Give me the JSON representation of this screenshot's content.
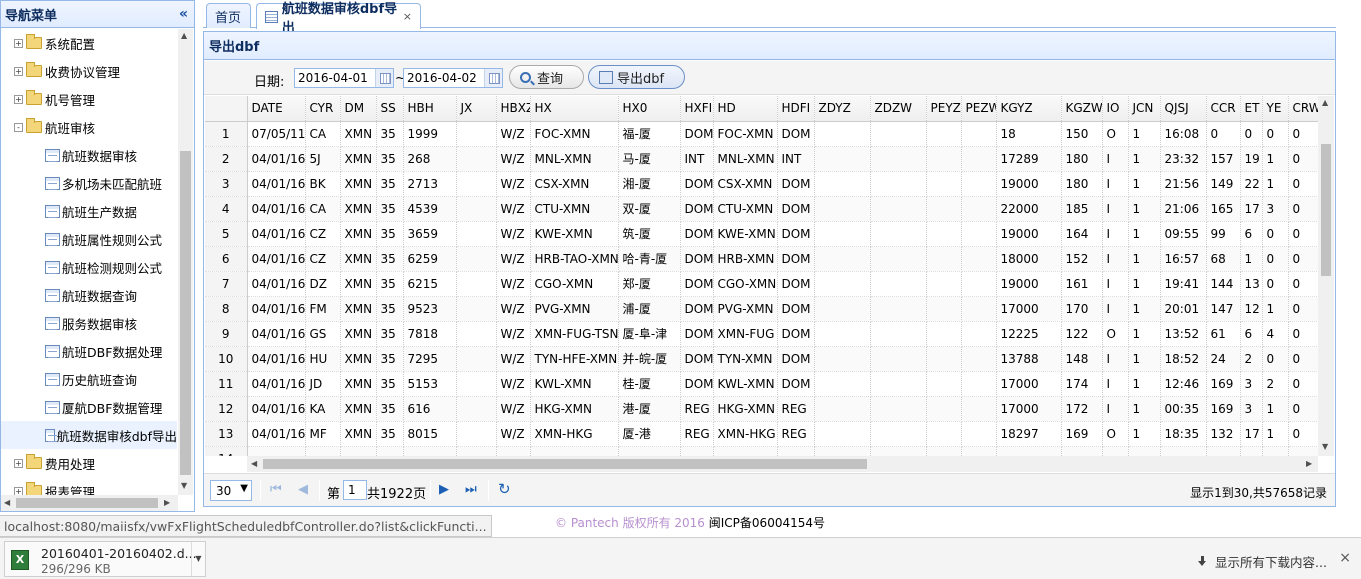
{
  "sidebar": {
    "title": "导航菜单",
    "collapse_icon": "«",
    "nodes": [
      {
        "label": "系统配置",
        "type": "folder",
        "state": "+"
      },
      {
        "label": "收费协议管理",
        "type": "folder",
        "state": "+"
      },
      {
        "label": "机号管理",
        "type": "folder",
        "state": "+"
      },
      {
        "label": "航班审核",
        "type": "folder",
        "state": "-"
      },
      {
        "label": "航班数据审核",
        "type": "file"
      },
      {
        "label": "多机场未匹配航班",
        "type": "file"
      },
      {
        "label": "航班生产数据",
        "type": "file"
      },
      {
        "label": "航班属性规则公式",
        "type": "file"
      },
      {
        "label": "航班检测规则公式",
        "type": "file"
      },
      {
        "label": "航班数据查询",
        "type": "file"
      },
      {
        "label": "服务数据审核",
        "type": "file"
      },
      {
        "label": "航班DBF数据处理",
        "type": "file"
      },
      {
        "label": "历史航班查询",
        "type": "file"
      },
      {
        "label": "厦航DBF数据管理",
        "type": "file"
      },
      {
        "label": "航班数据审核dbf导出",
        "type": "file",
        "selected": true
      },
      {
        "label": "费用处理",
        "type": "folder",
        "state": "+"
      },
      {
        "label": "报表管理",
        "type": "folder",
        "state": "+"
      }
    ]
  },
  "tabs": {
    "home": "首页",
    "active": "航班数据审核dbf导出",
    "close": "×"
  },
  "panel": {
    "title": "导出dbf"
  },
  "toolbar": {
    "date_label": "日期:",
    "date_from": "2016-04-01",
    "date_sep": "~",
    "date_to": "2016-04-02",
    "query_label": "查询",
    "export_label": "导出dbf"
  },
  "grid": {
    "columns": [
      "DATE",
      "CYR",
      "DM",
      "SS",
      "HBH",
      "JX",
      "HBXZ",
      "HX",
      "HX0",
      "HXFI",
      "HD",
      "HDFI",
      "ZDYZ",
      "ZDZW",
      "PEYZ",
      "PEZW",
      "KGYZ",
      "KGZW",
      "IO",
      "JCN",
      "QJSJ",
      "CCR",
      "ET",
      "YE",
      "CRWH"
    ],
    "rows": [
      [
        "07/05/11",
        "CA",
        "XMN",
        "35",
        "1999",
        "",
        "W/Z",
        "FOC-XMN",
        "福-厦",
        "DOM",
        "FOC-XMN",
        "DOM",
        "",
        "",
        "",
        "",
        "18",
        "150",
        "O",
        "1",
        "16:08",
        "0",
        "0",
        "0",
        "0"
      ],
      [
        "04/01/16",
        "5J",
        "XMN",
        "35",
        "268",
        "",
        "W/Z",
        "MNL-XMN",
        "马-厦",
        "INT",
        "MNL-XMN",
        "INT",
        "",
        "",
        "",
        "",
        "17289",
        "180",
        "I",
        "1",
        "23:32",
        "157",
        "19",
        "1",
        "0"
      ],
      [
        "04/01/16",
        "BK",
        "XMN",
        "35",
        "2713",
        "",
        "W/Z",
        "CSX-XMN",
        "湘-厦",
        "DOM",
        "CSX-XMN",
        "DOM",
        "",
        "",
        "",
        "",
        "19000",
        "180",
        "I",
        "1",
        "21:56",
        "149",
        "22",
        "1",
        "0"
      ],
      [
        "04/01/16",
        "CA",
        "XMN",
        "35",
        "4539",
        "",
        "W/Z",
        "CTU-XMN",
        "双-厦",
        "DOM",
        "CTU-XMN",
        "DOM",
        "",
        "",
        "",
        "",
        "22000",
        "185",
        "I",
        "1",
        "21:06",
        "165",
        "17",
        "3",
        "0"
      ],
      [
        "04/01/16",
        "CZ",
        "XMN",
        "35",
        "3659",
        "",
        "W/Z",
        "KWE-XMN",
        "筑-厦",
        "DOM",
        "KWE-XMN",
        "DOM",
        "",
        "",
        "",
        "",
        "19000",
        "164",
        "I",
        "1",
        "09:55",
        "99",
        "6",
        "0",
        "0"
      ],
      [
        "04/01/16",
        "CZ",
        "XMN",
        "35",
        "6259",
        "",
        "W/Z",
        "HRB-TAO-XMN",
        "哈-青-厦",
        "DOM",
        "HRB-XMN",
        "DOM",
        "",
        "",
        "",
        "",
        "18000",
        "152",
        "I",
        "1",
        "16:57",
        "68",
        "1",
        "0",
        "0"
      ],
      [
        "04/01/16",
        "DZ",
        "XMN",
        "35",
        "6215",
        "",
        "W/Z",
        "CGO-XMN",
        "郑-厦",
        "DOM",
        "CGO-XMN",
        "DOM",
        "",
        "",
        "",
        "",
        "19000",
        "161",
        "I",
        "1",
        "19:41",
        "144",
        "13",
        "0",
        "0"
      ],
      [
        "04/01/16",
        "FM",
        "XMN",
        "35",
        "9523",
        "",
        "W/Z",
        "PVG-XMN",
        "浦-厦",
        "DOM",
        "PVG-XMN",
        "DOM",
        "",
        "",
        "",
        "",
        "17000",
        "170",
        "I",
        "1",
        "20:01",
        "147",
        "12",
        "1",
        "0"
      ],
      [
        "04/01/16",
        "GS",
        "XMN",
        "35",
        "7818",
        "",
        "W/Z",
        "XMN-FUG-TSN",
        "厦-阜-津",
        "DOM",
        "XMN-FUG",
        "DOM",
        "",
        "",
        "",
        "",
        "12225",
        "122",
        "O",
        "1",
        "13:52",
        "61",
        "6",
        "4",
        "0"
      ],
      [
        "04/01/16",
        "HU",
        "XMN",
        "35",
        "7295",
        "",
        "W/Z",
        "TYN-HFE-XMN",
        "并-皖-厦",
        "DOM",
        "TYN-XMN",
        "DOM",
        "",
        "",
        "",
        "",
        "13788",
        "148",
        "I",
        "1",
        "18:52",
        "24",
        "2",
        "0",
        "0"
      ],
      [
        "04/01/16",
        "JD",
        "XMN",
        "35",
        "5153",
        "",
        "W/Z",
        "KWL-XMN",
        "桂-厦",
        "DOM",
        "KWL-XMN",
        "DOM",
        "",
        "",
        "",
        "",
        "17000",
        "174",
        "I",
        "1",
        "12:46",
        "169",
        "3",
        "2",
        "0"
      ],
      [
        "04/01/16",
        "KA",
        "XMN",
        "35",
        "616",
        "",
        "W/Z",
        "HKG-XMN",
        "港-厦",
        "REG",
        "HKG-XMN",
        "REG",
        "",
        "",
        "",
        "",
        "17000",
        "172",
        "I",
        "1",
        "00:35",
        "169",
        "3",
        "1",
        "0"
      ],
      [
        "04/01/16",
        "MF",
        "XMN",
        "35",
        "8015",
        "",
        "W/Z",
        "XMN-HKG",
        "厦-港",
        "REG",
        "XMN-HKG",
        "REG",
        "",
        "",
        "",
        "",
        "18297",
        "169",
        "O",
        "1",
        "18:35",
        "132",
        "17",
        "1",
        "0"
      ],
      [
        "",
        "",
        "",
        "",
        "",
        "",
        "",
        "",
        "",
        "",
        "",
        "",
        "",
        "",
        "",
        "",
        "",
        "",
        "",
        "",
        "",
        "",
        "",
        "",
        ""
      ]
    ]
  },
  "pager": {
    "page_size": "30",
    "page_prefix": "第",
    "page_number": "1",
    "page_suffix": "共1922页",
    "info": "显示1到30,共57658记录"
  },
  "footer": {
    "copyright": "© Pantech 版权所有 2016",
    "icp": "闽ICP备06004154号"
  },
  "status": {
    "url": "localhost:8080/maiisfx/vwFxFlightScheduledbfController.do?list&clickFuncti..."
  },
  "download": {
    "filename": "20160401-20160402.d...",
    "size": "296/296 KB",
    "show_all": "显示所有下载内容...",
    "close": "×"
  }
}
